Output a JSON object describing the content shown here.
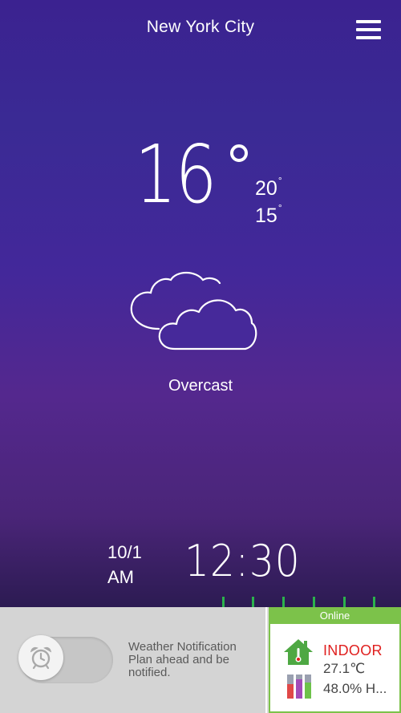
{
  "header": {
    "city": "New York City"
  },
  "weather": {
    "current_temp": "16",
    "high": "20",
    "low": "15",
    "degree_symbol": "°",
    "condition": "Overcast"
  },
  "clock": {
    "date": "10/1",
    "ampm": "AM",
    "time": "12:30"
  },
  "notification": {
    "line1": "Weather Notification",
    "line2": "Plan ahead and be",
    "line3": "notified.",
    "enabled": false
  },
  "indoor": {
    "status": "Online",
    "label": "INDOOR",
    "temperature": "27.1℃",
    "humidity": "48.0% H..."
  },
  "colors": {
    "accent_green": "#7cc24a",
    "tick_green": "#2bb24c",
    "indoor_red": "#e0201f"
  }
}
